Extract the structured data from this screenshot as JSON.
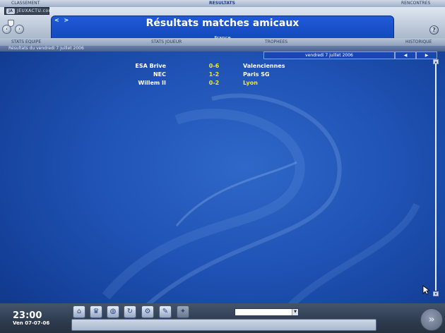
{
  "menu": {
    "classement": "CLASSEMENT",
    "resultats": "RESULTATS",
    "rencontres": "RENCONTRES"
  },
  "logo": {
    "badge": "JA",
    "text": "JEUXACTU.com"
  },
  "header": {
    "nav_arrows": "< >",
    "title": "Résultats matches amicaux",
    "subtitle": "France",
    "help_glyph": "?"
  },
  "tabs": {
    "stats_equipe": "STATS EQUIPE",
    "stats_joueur": "STATS JOUEUR",
    "trophees": "TROPHEES",
    "historique": "HISTORIQUE"
  },
  "date_bar": {
    "label": "Résultats du vendredi 7 juillet 2006",
    "selected_date": "vendredi 7 juillet 2006",
    "prev_glyph": "◀",
    "next_glyph": "▶"
  },
  "results": [
    {
      "home": "ESA Brive",
      "score": "0-6",
      "away": "Valenciennes",
      "away_winner": false
    },
    {
      "home": "NEC",
      "score": "1-2",
      "away": "Paris SG",
      "away_winner": false
    },
    {
      "home": "Willem II",
      "score": "0-2",
      "away": "Lyon",
      "away_winner": true
    }
  ],
  "status": {
    "time": "23:00",
    "date": "Ven 07-07-06"
  },
  "toolbar": {
    "icons": [
      "home-icon",
      "trophy-icon",
      "globe-icon",
      "refresh-icon",
      "settings-icon",
      "notepad-icon",
      "star-icon"
    ],
    "dropdown_value": ""
  },
  "next_glyph": "»",
  "colors": {
    "background": "#1f52b4",
    "score": "#f0e63a",
    "title_panel": "#1a50cc"
  }
}
